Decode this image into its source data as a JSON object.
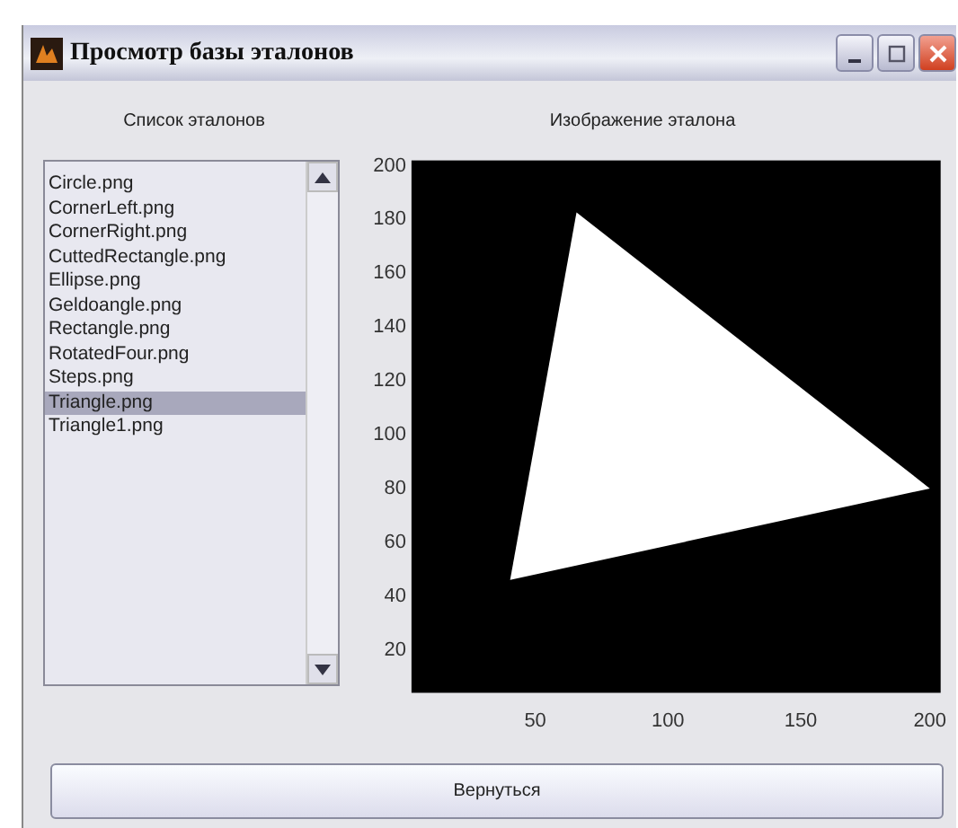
{
  "window": {
    "title": "Просмотр базы эталонов"
  },
  "list_header": "Список эталонов",
  "image_header": "Изображение эталона",
  "files": [
    {
      "name": "Circle.png",
      "selected": false
    },
    {
      "name": "CornerLeft.png",
      "selected": false
    },
    {
      "name": "CornerRight.png",
      "selected": false
    },
    {
      "name": "CuttedRectangle.png",
      "selected": false
    },
    {
      "name": "Ellipse.png",
      "selected": false
    },
    {
      "name": "Geldoangle.png",
      "selected": false
    },
    {
      "name": "Rectangle.png",
      "selected": false
    },
    {
      "name": "RotatedFour.png",
      "selected": false
    },
    {
      "name": "Steps.png",
      "selected": false
    },
    {
      "name": "Triangle.png",
      "selected": true
    },
    {
      "name": "Triangle1.png",
      "selected": false
    }
  ],
  "axes": {
    "y_ticks": [
      "200",
      "180",
      "160",
      "140",
      "120",
      "100",
      "80",
      "60",
      "40",
      "20"
    ],
    "x_ticks": [
      "50",
      "100",
      "150",
      "200"
    ]
  },
  "button": "Вернуться"
}
